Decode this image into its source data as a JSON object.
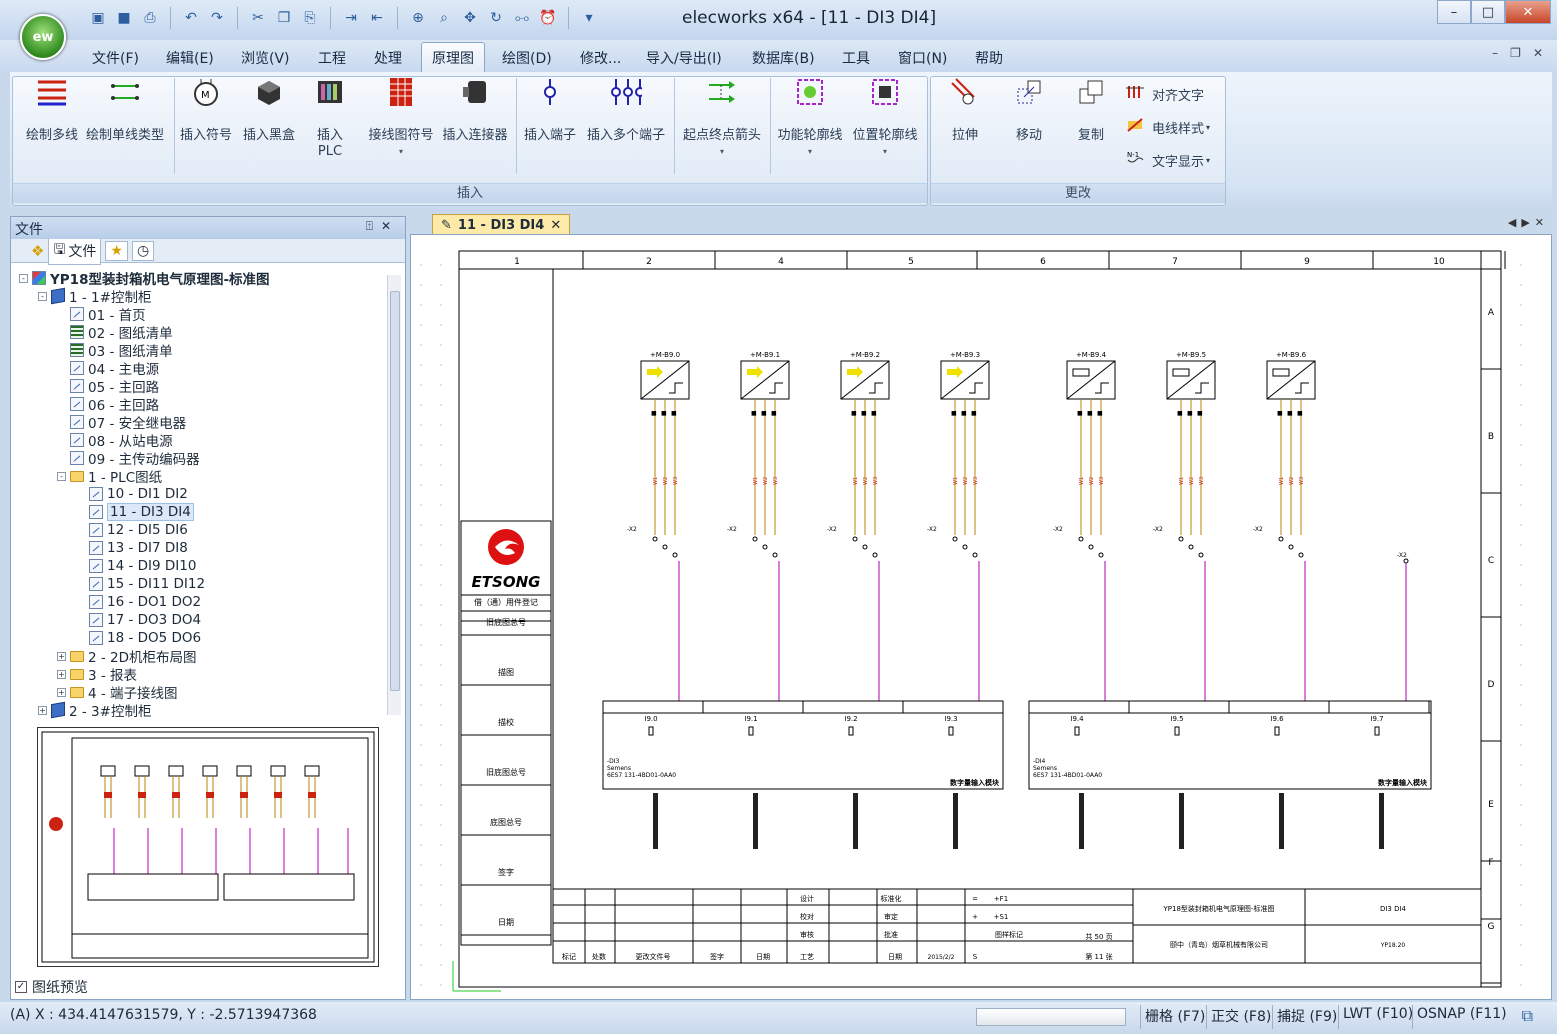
{
  "app": {
    "logo": "ew",
    "title": "elecworks x64 - [11 - DI3 DI4]"
  },
  "qat_icons": [
    "new-icon",
    "save-icon",
    "print-icon",
    "undo-icon",
    "redo-icon",
    "cut-icon",
    "copy-icon",
    "paste-icon",
    "import-icon",
    "export-icon",
    "zoom-window-icon",
    "zoom-icon",
    "pan-icon",
    "regen-icon",
    "binoculars-icon",
    "clock-icon",
    "dropdown-icon"
  ],
  "menu": [
    "文件(F)",
    "编辑(E)",
    "浏览(V)",
    "工程",
    "处理",
    "原理图",
    "绘图(D)",
    "修改...",
    "导入/导出(I)",
    "数据库(B)",
    "工具",
    "窗口(N)",
    "帮助"
  ],
  "menu_active": "原理图",
  "ribbon": {
    "insert_group": "插入",
    "modify_group": "更改",
    "buttons": [
      {
        "label": "绘制多线",
        "icon": "multiline-icon"
      },
      {
        "label": "绘制单线类型",
        "icon": "singleline-icon"
      },
      {
        "label": "插入符号",
        "icon": "motor-symbol-icon"
      },
      {
        "label": "插入黑盒",
        "icon": "blackbox-icon"
      },
      {
        "label": "插入\nPLC",
        "icon": "plc-icon"
      },
      {
        "label": "接线图符号",
        "icon": "wiring-symbol-icon"
      },
      {
        "label": "插入连接器",
        "icon": "connector-icon"
      },
      {
        "label": "插入端子",
        "icon": "terminal-icon"
      },
      {
        "label": "插入多个端子",
        "icon": "multi-terminal-icon"
      },
      {
        "label": "起点终点箭头",
        "icon": "origin-dest-arrow-icon"
      },
      {
        "label": "功能轮廓线",
        "icon": "function-outline-icon"
      },
      {
        "label": "位置轮廓线",
        "icon": "location-outline-icon"
      },
      {
        "label": "拉伸",
        "icon": "stretch-icon"
      },
      {
        "label": "移动",
        "icon": "move-icon"
      },
      {
        "label": "复制",
        "icon": "copy-icon"
      }
    ],
    "small": [
      {
        "label": "对齐文字",
        "icon": "align-text-icon"
      },
      {
        "label": "电线样式",
        "icon": "wire-style-icon"
      },
      {
        "label": "文字显示",
        "icon": "text-display-icon"
      }
    ]
  },
  "filepanel": {
    "title": "文件",
    "pin": "⍐",
    "close": "✕",
    "tab": "文件",
    "preview_label": "图纸预览"
  },
  "tree": [
    {
      "label": "YP18型装封箱机电气原理图-标准图",
      "level": 0,
      "icon": "proj",
      "exp": "-",
      "bold": true
    },
    {
      "label": "1 - 1#控制柜",
      "level": 1,
      "icon": "book",
      "exp": "-"
    },
    {
      "label": "01 - 首页",
      "level": 2,
      "icon": "page"
    },
    {
      "label": "02 - 图纸清单",
      "level": 2,
      "icon": "grid"
    },
    {
      "label": "03 - 图纸清单",
      "level": 2,
      "icon": "grid"
    },
    {
      "label": "04 - 主电源",
      "level": 2,
      "icon": "page"
    },
    {
      "label": "05 - 主回路",
      "level": 2,
      "icon": "page"
    },
    {
      "label": "06 - 主回路",
      "level": 2,
      "icon": "page"
    },
    {
      "label": "07 - 安全继电器",
      "level": 2,
      "icon": "page"
    },
    {
      "label": "08 - 从站电源",
      "level": 2,
      "icon": "page"
    },
    {
      "label": "09 - 主传动编码器",
      "level": 2,
      "icon": "page"
    },
    {
      "label": "1 - PLC图纸",
      "level": 2,
      "icon": "folder",
      "exp": "-"
    },
    {
      "label": "10 - DI1 DI2",
      "level": 3,
      "icon": "page"
    },
    {
      "label": "11 - DI3 DI4",
      "level": 3,
      "icon": "page",
      "selected": true
    },
    {
      "label": "12 - DI5 DI6",
      "level": 3,
      "icon": "page"
    },
    {
      "label": "13 - DI7 DI8",
      "level": 3,
      "icon": "page"
    },
    {
      "label": "14 - DI9 DI10",
      "level": 3,
      "icon": "page"
    },
    {
      "label": "15 - DI11 DI12",
      "level": 3,
      "icon": "page"
    },
    {
      "label": "16 - DO1 DO2",
      "level": 3,
      "icon": "page"
    },
    {
      "label": "17 - DO3 DO4",
      "level": 3,
      "icon": "page"
    },
    {
      "label": "18 - DO5 DO6",
      "level": 3,
      "icon": "page"
    },
    {
      "label": "2 - 2D机柜布局图",
      "level": 2,
      "icon": "folder",
      "exp": "+"
    },
    {
      "label": "3 - 报表",
      "level": 2,
      "icon": "folder",
      "exp": "+"
    },
    {
      "label": "4 - 端子接线图",
      "level": 2,
      "icon": "folder",
      "exp": "+"
    },
    {
      "label": "2 - 3#控制柜",
      "level": 1,
      "icon": "book",
      "exp": "+"
    }
  ],
  "doc_tab": "11 - DI3 DI4",
  "drawing": {
    "columns": [
      "1",
      "2",
      "4",
      "5",
      "6",
      "7",
      "9",
      "10"
    ],
    "rows": [
      "A",
      "B",
      "C",
      "D",
      "E",
      "F",
      "G"
    ],
    "sensors": [
      "+M-B9.0",
      "+M-B9.1",
      "+M-B9.2",
      "+M-B9.3",
      "+M-B9.4",
      "+M-B9.5",
      "+M-B9.6"
    ],
    "inputs_left": [
      "I9.0",
      "I9.1",
      "I9.2",
      "I9.3"
    ],
    "inputs_right": [
      "I9.4",
      "I9.5",
      "I9.6",
      "I9.7"
    ],
    "module_left": {
      "tag": "-DI3",
      "maker": "Semens",
      "part": "6ES7 131-4BD01-0AA0",
      "title": "数字量输入模块"
    },
    "module_right": {
      "tag": "-DI4",
      "maker": "Semens",
      "part": "6ES7 131-4BD01-0AA0",
      "title": "数字量输入模块"
    },
    "logo": "ETSONG",
    "side_labels": [
      "借（通）用件登记",
      "旧底图总号",
      "描图",
      "描校",
      "旧底图总号",
      "底图总号",
      "签字",
      "日期"
    ],
    "titleblock": {
      "project": "YP18型装封箱机电气原理图-标准图",
      "sheet": "DI3 DI4",
      "company": "颐中（青岛）烟草机械有限公司",
      "code": "YP18.20",
      "date": "2015/2/2",
      "total": "共 50 页",
      "page": "第 11 张",
      "cells": [
        "设计",
        "标准化",
        "校对",
        "审定",
        "审核",
        "批准",
        "标记",
        "处数",
        "更改文件号",
        "签字",
        "日期",
        "工艺",
        "日期",
        "图样标记",
        "S",
        "=",
        "+F1",
        "+",
        "+S1"
      ]
    }
  },
  "status": {
    "coords": "(A) X : 434.4147631579, Y : -2.5713947368",
    "toggles": [
      "栅格 (F7)",
      "正交 (F8)",
      "捕捉 (F9)",
      "LWT (F10)",
      "OSNAP (F11)"
    ]
  }
}
